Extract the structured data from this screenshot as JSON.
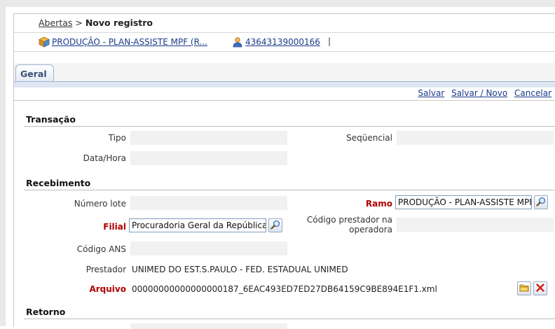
{
  "breadcrumb": {
    "link": "Abertas",
    "separator": ">",
    "current": "Novo registro"
  },
  "context": {
    "plan_label": "PRODUÇÃO - PLAN-ASSISTE MPF (R...",
    "person_label": "43643139000166",
    "pipe": "|"
  },
  "tabs": [
    {
      "label": "Geral",
      "active": true
    }
  ],
  "actions": {
    "save": "Salvar",
    "save_new": "Salvar / Novo",
    "cancel": "Cancelar"
  },
  "sections": {
    "transacao": "Transação",
    "recebimento": "Recebimento",
    "retorno": "Retorno"
  },
  "transacao": {
    "tipo_label": "Tipo",
    "tipo_value": "",
    "sequencial_label": "Seqüencial",
    "sequencial_value": "",
    "datahora_label": "Data/Hora",
    "datahora_value": ""
  },
  "recebimento": {
    "numero_lote_label": "Número lote",
    "numero_lote_value": "",
    "ramo_label": "Ramo",
    "ramo_value": "PRODUÇÃO - PLAN-ASSISTE MPF (R",
    "filial_label": "Filial",
    "filial_value": "Procuradoria Geral da República",
    "codigo_prestador_label_1": "Código prestador na",
    "codigo_prestador_label_2": "operadora",
    "codigo_prestador_value": "",
    "codigo_ans_label": "Código ANS",
    "codigo_ans_value": "",
    "prestador_label": "Prestador",
    "prestador_value": "UNIMED DO EST.S.PAULO - FED. ESTADUAL UNIMED",
    "arquivo_label": "Arquivo",
    "arquivo_value": "00000000000000000187_6EAC493ED7ED27DB64159C9BE894E1F1.xml"
  },
  "icons": {
    "plan": "package-icon",
    "person": "user-icon",
    "lookup": "magnifier-icon",
    "open_file": "folder-icon",
    "delete": "close-icon"
  },
  "colors": {
    "required_label": "#b00000",
    "link": "#1a3a8a",
    "tab_border": "#9fb3cf"
  }
}
